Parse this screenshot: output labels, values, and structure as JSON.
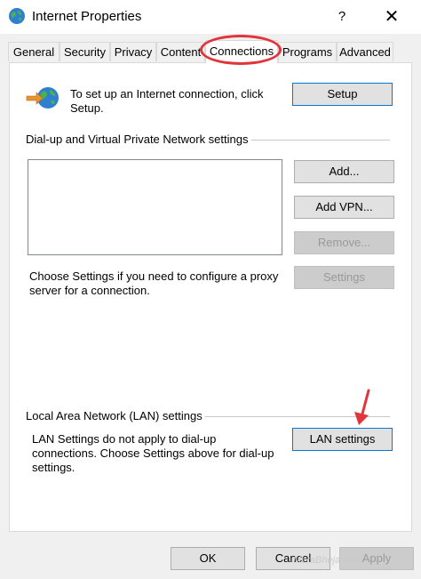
{
  "window": {
    "title": "Internet Properties",
    "help_glyph": "?",
    "close_glyph": "✕"
  },
  "tabs": [
    {
      "label": "General"
    },
    {
      "label": "Security"
    },
    {
      "label": "Privacy"
    },
    {
      "label": "Content"
    },
    {
      "label": "Connections",
      "active": true
    },
    {
      "label": "Programs"
    },
    {
      "label": "Advanced"
    }
  ],
  "setup": {
    "text": "To set up an Internet connection, click Setup.",
    "button": "Setup"
  },
  "dialup": {
    "section_title": "Dial-up and Virtual Private Network settings",
    "add_button": "Add...",
    "add_vpn_button": "Add VPN...",
    "remove_button": "Remove...",
    "settings_text": "Choose Settings if you need to configure a proxy server for a connection.",
    "settings_button": "Settings"
  },
  "lan": {
    "section_title": "Local Area Network (LAN) settings",
    "text": "LAN Settings do not apply to dial-up connections. Choose Settings above for dial-up settings.",
    "button": "LAN settings"
  },
  "footer": {
    "ok": "OK",
    "cancel": "Cancel",
    "apply": "Apply"
  },
  "watermark": "MeraBheja.com",
  "colors": {
    "annotation": "#e0353b",
    "focus_border": "#0078d7"
  },
  "icons": {
    "title": "globe-icon",
    "setup": "network-setup-icon",
    "annotation_arrow": "red-arrow-icon"
  }
}
